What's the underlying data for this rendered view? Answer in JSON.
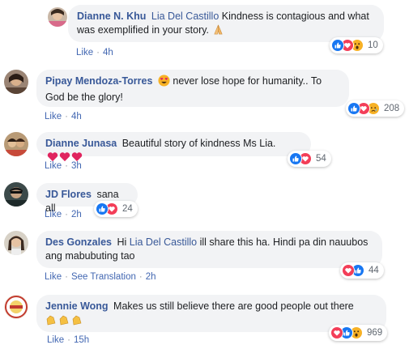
{
  "comments": [
    {
      "author": "Dianne N. Khu",
      "mention": "Lia Del Castillo",
      "text": "Kindness is contagious and what was exemplified in your story.",
      "emoji": "pray",
      "actions": [
        "Like"
      ],
      "time": "4h",
      "reactions": [
        "like",
        "love",
        "wow"
      ],
      "count": "10"
    },
    {
      "author": "Pipay Mendoza-Torres",
      "leading_emoji": "heart-eyes",
      "text": "never lose hope for humanity.. To God be the glory!",
      "actions": [
        "Like"
      ],
      "time": "4h",
      "reactions": [
        "like",
        "love",
        "sad"
      ],
      "count": "208"
    },
    {
      "author": "Dianne Junasa",
      "text": "Beautiful story of kindness Ms Lia.",
      "emoji": "hearts",
      "actions": [
        "Like"
      ],
      "time": "3h",
      "reactions": [
        "like",
        "love"
      ],
      "count": "54"
    },
    {
      "author": "JD Flores",
      "text": "sana all",
      "actions": [
        "Like"
      ],
      "time": "2h",
      "reactions": [
        "like",
        "love"
      ],
      "count": "24"
    },
    {
      "author": "Des Gonzales",
      "text_before": "Hi",
      "mention": "Lia Del Castillo",
      "text": "ill share this ha. Hindi pa din nauubos ang mabubuting tao",
      "actions": [
        "Like",
        "See Translation"
      ],
      "time": "2h",
      "reactions": [
        "love",
        "like"
      ],
      "count": "44"
    },
    {
      "author": "Jennie Wong",
      "text": "Makes us still believe there are good people out there",
      "emoji": "clap",
      "actions": [
        "Like"
      ],
      "time": "15h",
      "reactions": [
        "love",
        "like",
        "wow"
      ],
      "count": "969"
    }
  ],
  "colors": {
    "name_link": "#385898",
    "action_link": "#4267b2",
    "bubble_bg": "#f2f3f5",
    "like": "#1877f2",
    "love": "#f33e58",
    "wow_sad": "#f7b125"
  }
}
